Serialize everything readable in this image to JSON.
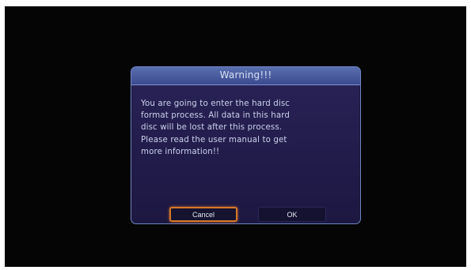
{
  "dialog": {
    "title": "Warning!!!",
    "message": "You are going to enter the hard disc\nformat process. All data in this hard\ndisc will be lost after this process.\nPlease read the user manual to get\nmore information!!",
    "buttons": {
      "cancel_label": "Cancel",
      "ok_label": "OK"
    },
    "focused_button": "cancel"
  },
  "colors": {
    "background": "#050505",
    "dialog_body": "#221c4b",
    "title_bar": "#4a5ba0",
    "border": "#6f86c8",
    "focus_ring": "#d4772a",
    "text": "#cbd2ec"
  }
}
